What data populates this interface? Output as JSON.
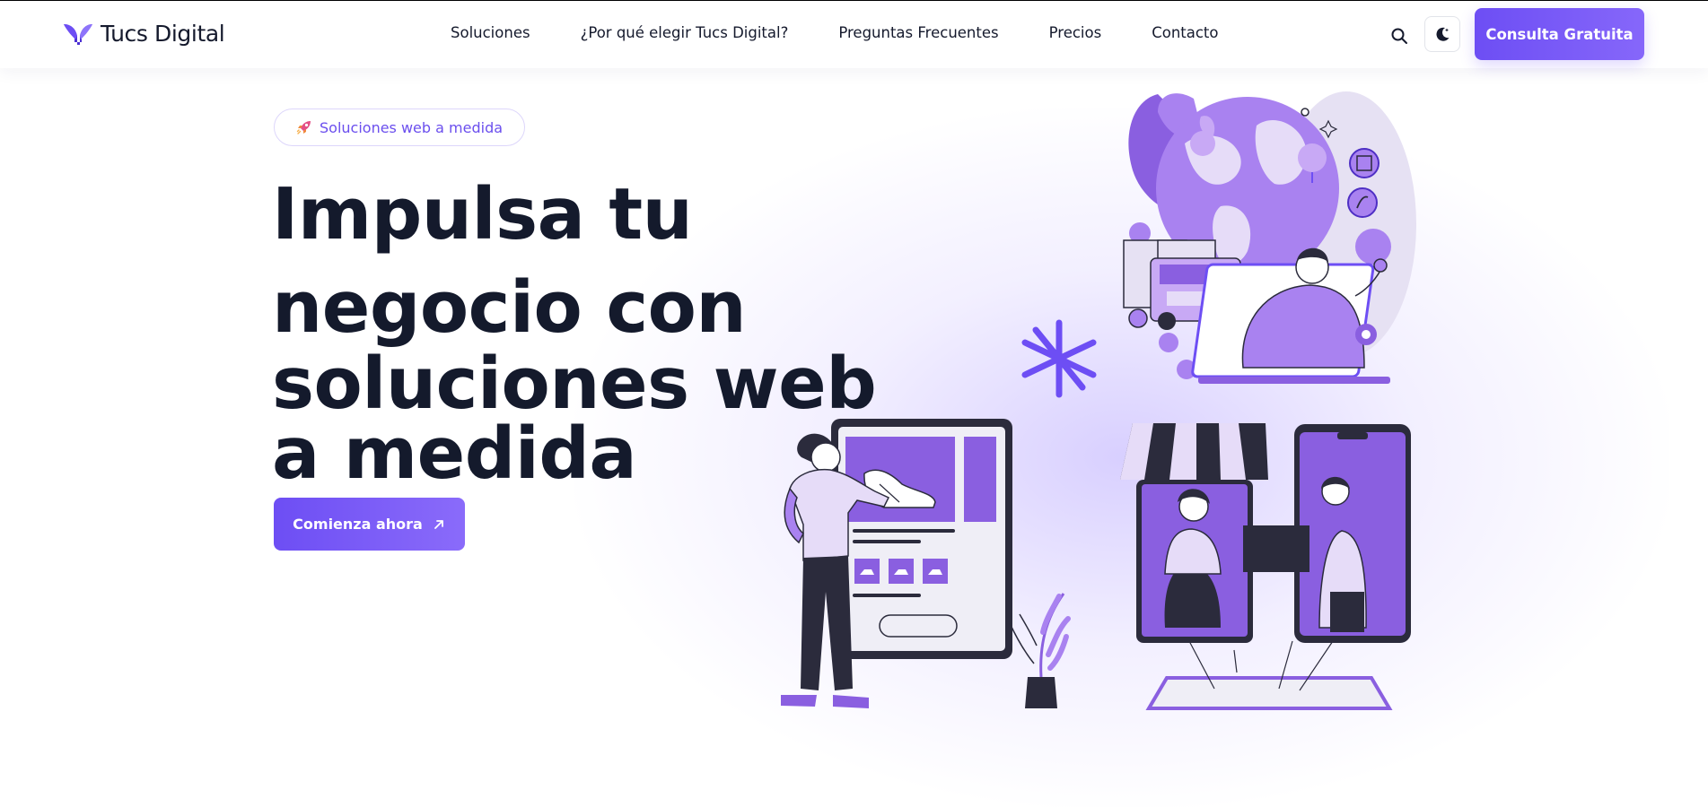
{
  "brand": {
    "name": "Tucs Digital",
    "logo_icon": "y-mark-logo-icon",
    "accent": "#6d4ef4"
  },
  "nav": {
    "items": [
      {
        "label": "Soluciones"
      },
      {
        "label": "¿Por qué elegir Tucs Digital?"
      },
      {
        "label": "Preguntas Frecuentes"
      },
      {
        "label": "Precios"
      },
      {
        "label": "Contacto"
      }
    ]
  },
  "header_actions": {
    "search_icon": "search-icon",
    "theme_icon": "moon-icon",
    "cta_label": "Consulta Gratuita"
  },
  "hero": {
    "badge_icon": "rocket-icon",
    "badge_label": "Soluciones web a medida",
    "title_lines": [
      "Impulsa tu",
      "negocio con",
      "soluciones web",
      "a medida"
    ],
    "cta_label": "Comienza ahora",
    "cta_icon": "arrow-up-right-icon",
    "illustration": "ecommerce-illustration"
  }
}
